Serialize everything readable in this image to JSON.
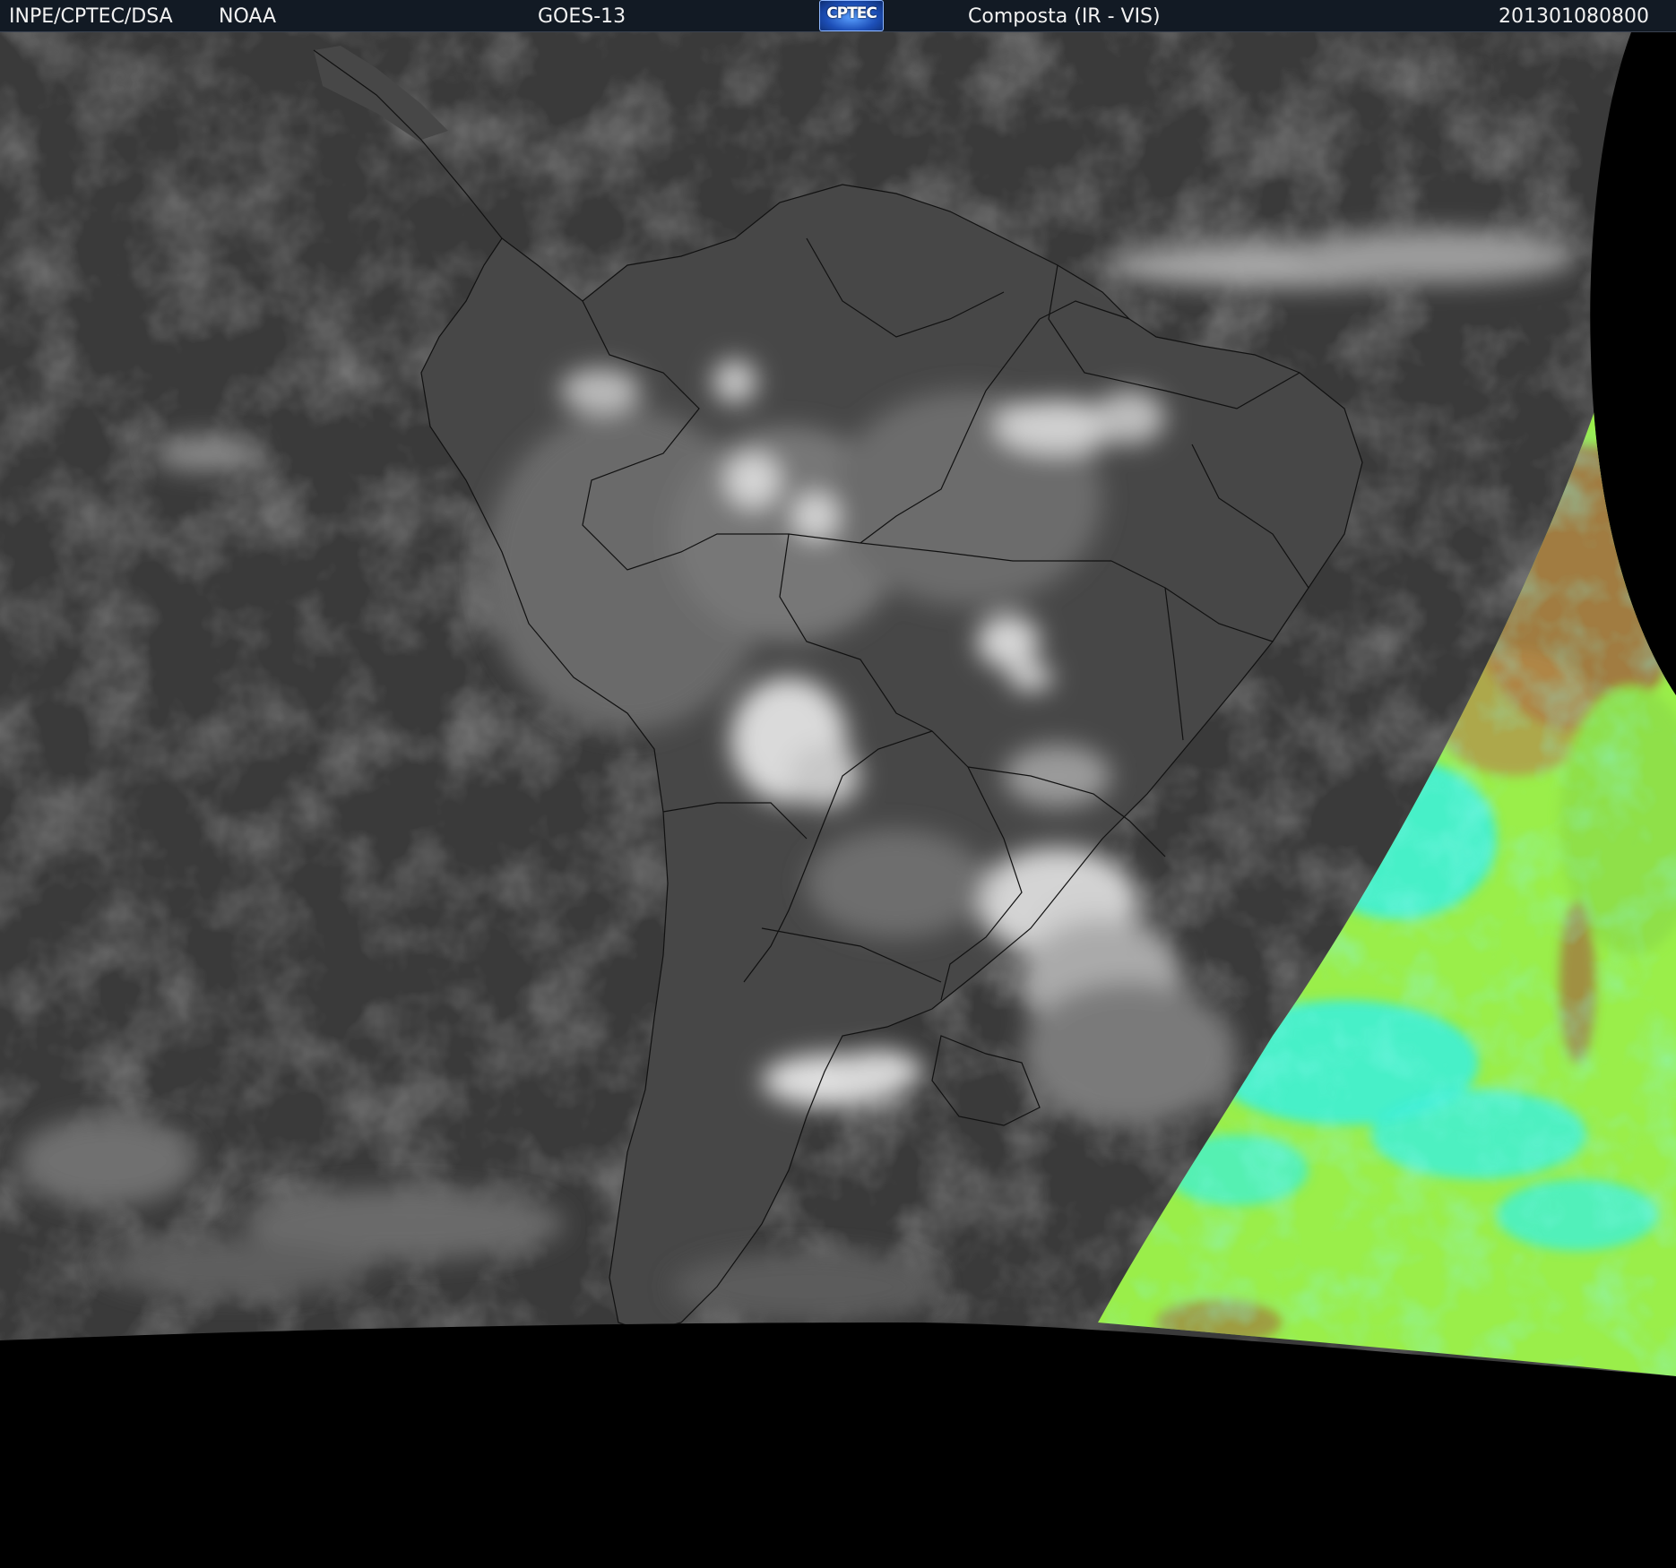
{
  "header": {
    "organization": "INPE/CPTEC/DSA",
    "agency": "NOAA",
    "satellite": "GOES-13",
    "logo_text": "CPTEC",
    "product": "Composta (IR - VIS)",
    "timestamp": "201301080800"
  },
  "colors": {
    "header_background": "#121a24",
    "space_background": "#000000",
    "ocean_ir": "#3a3a3a",
    "land_ir": "#444444",
    "cloud": "#d8d8d8",
    "vis_green": "#9aee4a",
    "vis_cyan": "#3ff0d6",
    "vis_brown": "#a2683e"
  }
}
